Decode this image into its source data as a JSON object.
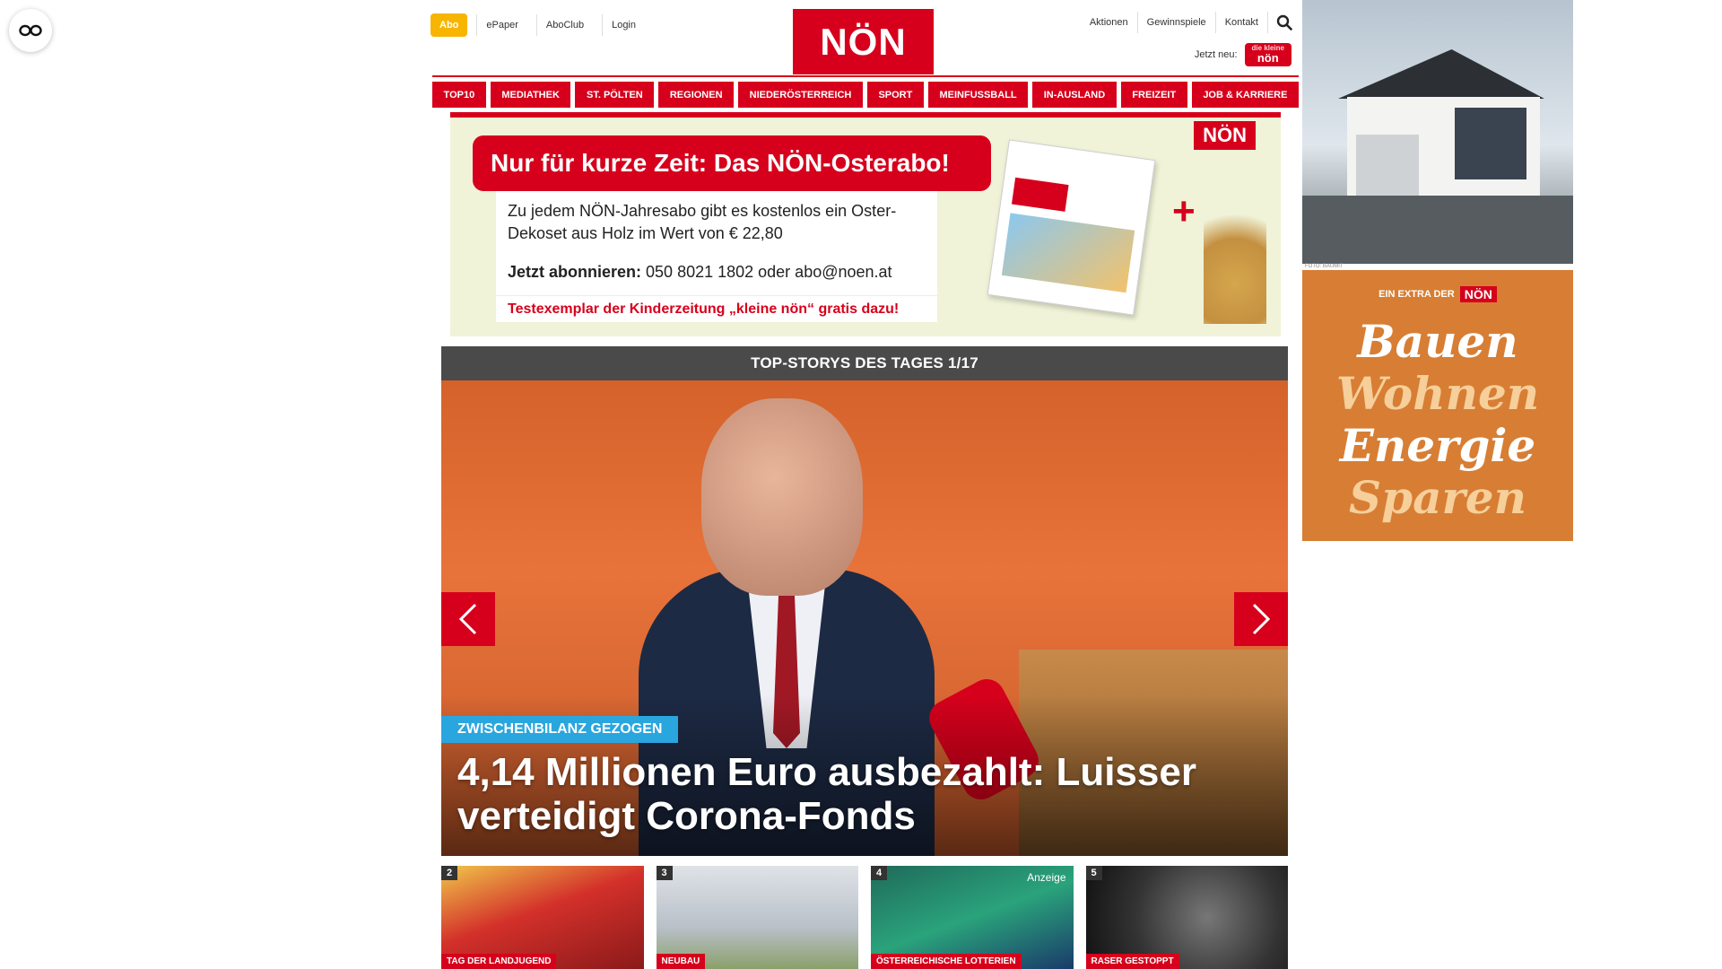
{
  "header": {
    "abo_label": "Abo",
    "top_links": [
      "ePaper",
      "AboClub",
      "Login"
    ],
    "logo_text": "NÖN",
    "right_links": [
      "Aktionen",
      "Gewinnspiele",
      "Kontakt"
    ],
    "jetzt_neu_label": "Jetzt neu:",
    "kleine_logo_top": "die kleine",
    "kleine_logo_text": "nön"
  },
  "nav": {
    "items": [
      "TOP10",
      "MEDIATHEK",
      "ST. PÖLTEN",
      "REGIONEN",
      "NIEDERÖSTERREICH",
      "SPORT",
      "MEINFUSSBALL",
      "IN-AUSLAND",
      "FREIZEIT",
      "JOB & KARRIERE"
    ]
  },
  "promo": {
    "headline": "Nur für kurze Zeit: Das NÖN-Osterabo!",
    "body": "Zu jedem NÖN-Jahresabo gibt es kostenlos ein Oster-Dekoset aus Holz im Wert von € 22,80",
    "cta_bold": "Jetzt abonnieren:",
    "cta_rest": " 050 8021 1802 oder abo@noen.at",
    "footer": "Testexemplar der Kinderzeitung „kleine nön“ gratis dazu!",
    "logo": "NÖN"
  },
  "top_stories": {
    "bar_title": "TOP-STORYS DES TAGES 1/17",
    "tag": "ZWISCHENBILANZ GEZOGEN",
    "title": "4,14 Millionen Euro ausbezahlt: Luisser verteidigt Corona-Fonds",
    "thumbs": [
      {
        "num": "2",
        "category": "TAG DER LANDJUGEND",
        "label": ""
      },
      {
        "num": "3",
        "category": "NEUBAU",
        "label": ""
      },
      {
        "num": "4",
        "category": "ÖSTERREICHISCHE LOTTERIEN",
        "label": "Anzeige"
      },
      {
        "num": "5",
        "category": "RASER GESTOPPT",
        "label": ""
      }
    ]
  },
  "ads": {
    "house_credit": "FOTO: BAUMIT",
    "bauen": {
      "extra_label": "EIN EXTRA DER",
      "extra_logo": "NÖN",
      "words": [
        "Bauen",
        "Wohnen",
        "Energie",
        "Sparen"
      ]
    }
  },
  "colors": {
    "brand_red": "#d6001c",
    "abo_yellow": "#f7b500",
    "story_tag_blue": "#2aa6df",
    "ad_orange": "#d77e34"
  },
  "icons": [
    "reader-mode-icon",
    "search-icon",
    "chevron-left-icon",
    "chevron-right-icon"
  ]
}
